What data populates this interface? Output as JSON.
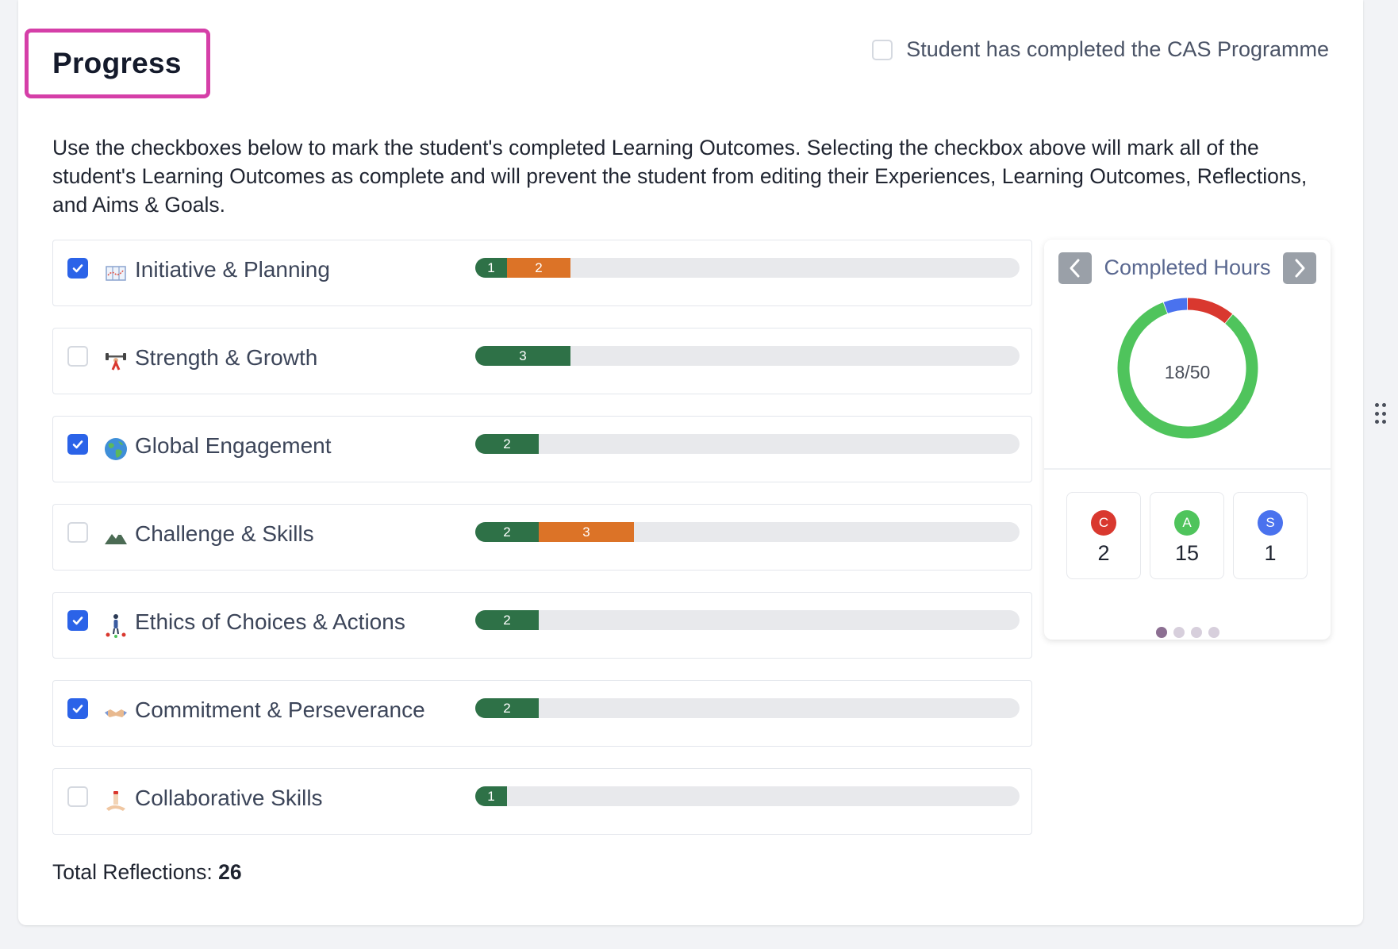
{
  "header": {
    "title": "Progress",
    "complete_label": "Student has completed the CAS Programme",
    "complete_checked": false
  },
  "description": "Use the checkboxes below to mark the student's completed Learning Outcomes. Selecting the checkbox above will mark all of the student's Learning Outcomes as complete and will prevent the student from editing their Experiences, Learning Outcomes, Reflections, and Aims & Goals.",
  "colors": {
    "green": "#2e7147",
    "orange": "#dc7327",
    "checkbox": "#2b63e8",
    "creativity": "#d9382f",
    "activity": "#4fc45c",
    "service": "#4a72ee",
    "highlight": "#d53fa8"
  },
  "outcomes": [
    {
      "label": "Initiative & Planning",
      "icon": "map-icon",
      "checked": true,
      "segments": [
        {
          "value": "1",
          "color": "green"
        },
        {
          "value": "2",
          "color": "orange"
        }
      ]
    },
    {
      "label": "Strength & Growth",
      "icon": "weightlifter-icon",
      "checked": false,
      "segments": [
        {
          "value": "3",
          "color": "green"
        }
      ]
    },
    {
      "label": "Global Engagement",
      "icon": "globe-icon",
      "checked": true,
      "segments": [
        {
          "value": "2",
          "color": "green"
        }
      ]
    },
    {
      "label": "Challenge & Skills",
      "icon": "mountain-icon",
      "checked": false,
      "segments": [
        {
          "value": "2",
          "color": "green"
        },
        {
          "value": "3",
          "color": "orange"
        }
      ]
    },
    {
      "label": "Ethics of Choices & Actions",
      "icon": "person-crossroads-icon",
      "checked": true,
      "segments": [
        {
          "value": "2",
          "color": "green"
        }
      ]
    },
    {
      "label": "Commitment & Perseverance",
      "icon": "handshake-icon",
      "checked": true,
      "segments": [
        {
          "value": "2",
          "color": "green"
        }
      ]
    },
    {
      "label": "Collaborative Skills",
      "icon": "stacked-hands-icon",
      "checked": false,
      "segments": [
        {
          "value": "1",
          "color": "green"
        }
      ]
    }
  ],
  "total": {
    "label": "Total Reflections:",
    "value": "26"
  },
  "hours": {
    "title": "Completed Hours",
    "completed": 18,
    "required": 50,
    "display": "18/50",
    "prev_icon": "chevron-left-icon",
    "next_icon": "chevron-right-icon",
    "categories": [
      {
        "key": "creativity",
        "letter": "C",
        "value": 2
      },
      {
        "key": "activity",
        "letter": "A",
        "value": 15
      },
      {
        "key": "service",
        "letter": "S",
        "value": 1
      }
    ],
    "pages": 4,
    "active_page": 0
  }
}
